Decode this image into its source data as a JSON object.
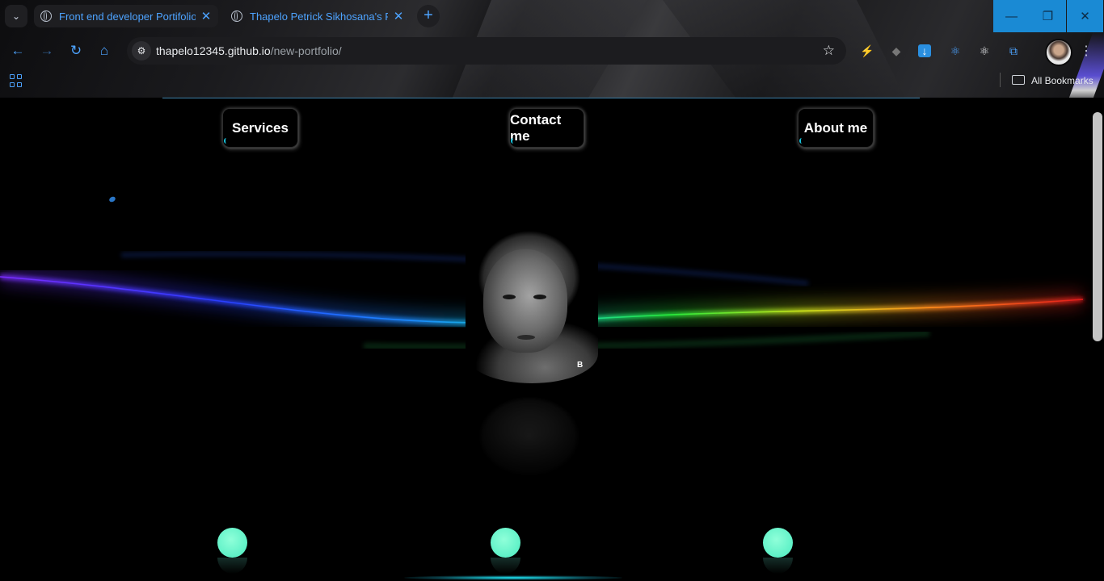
{
  "browser": {
    "tabs": [
      {
        "title": "Front end developer Portifolio",
        "active": true
      },
      {
        "title": "Thapelo Petrick Sikhosana's Po",
        "active": false
      }
    ],
    "address": {
      "host": "thapelo12345.github.io",
      "path": "/new-portfolio/"
    },
    "bookmarks_label": "All Bookmarks",
    "accent_color": "#4da3ff"
  },
  "page": {
    "nav": {
      "services": "Services",
      "contact": "Contact me",
      "about": "About me"
    },
    "portrait_shirt_text": "B",
    "colors": {
      "background": "#000000",
      "ball": "#5ef1c7",
      "nav_accent": "#18c7e0"
    }
  }
}
